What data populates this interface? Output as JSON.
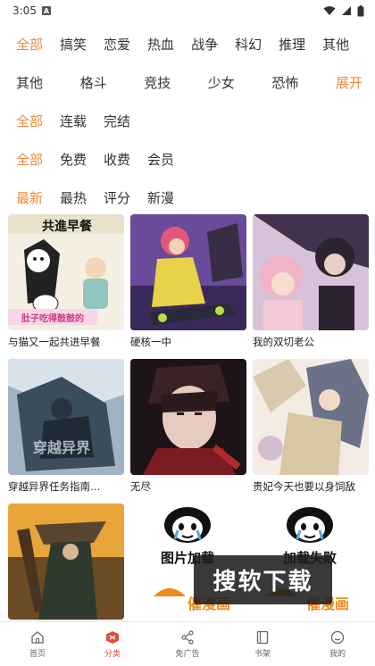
{
  "status_bar": {
    "time": "3:05",
    "badge": "A"
  },
  "filters": {
    "genre_row1": [
      "全部",
      "搞笑",
      "恋爱",
      "热血",
      "战争",
      "科幻",
      "推理",
      "其他"
    ],
    "genre_row2": [
      "其他",
      "格斗",
      "竞技",
      "少女",
      "恐怖",
      "展开"
    ],
    "status": [
      "全部",
      "连载",
      "完结"
    ],
    "price": [
      "全部",
      "免费",
      "收费",
      "会员"
    ],
    "sort": [
      "最新",
      "最热",
      "评分",
      "新漫"
    ]
  },
  "comics": [
    {
      "title": "与猫又一起共进早餐",
      "cover_text": "共進早餐",
      "cover_subtext": "肚子吃得鼓鼓的"
    },
    {
      "title": "硬核一中"
    },
    {
      "title": "我的双切老公"
    },
    {
      "title": "穿越异界任务指南…",
      "cover_text": "穿越异界"
    },
    {
      "title": "无尽"
    },
    {
      "title": "贵妃今天也要以身饲敌"
    },
    {
      "title": ""
    },
    {
      "title": "",
      "cover_text": "图片加载",
      "cover_subtext": "催漫画"
    },
    {
      "title": "",
      "cover_text": "加载失败",
      "cover_subtext": "催漫画"
    }
  ],
  "ad_overlay": {
    "text": "搜软下载"
  },
  "bottom_nav": [
    {
      "label": "首页",
      "icon": "home-icon"
    },
    {
      "label": "分类",
      "icon": "category-icon",
      "active": true
    },
    {
      "label": "免广告",
      "icon": "share-icon"
    },
    {
      "label": "书架",
      "icon": "bookshelf-icon"
    },
    {
      "label": "我的",
      "icon": "profile-icon"
    }
  ],
  "colors": {
    "accent": "#f08a3a",
    "nav_active": "#e24a3a"
  }
}
